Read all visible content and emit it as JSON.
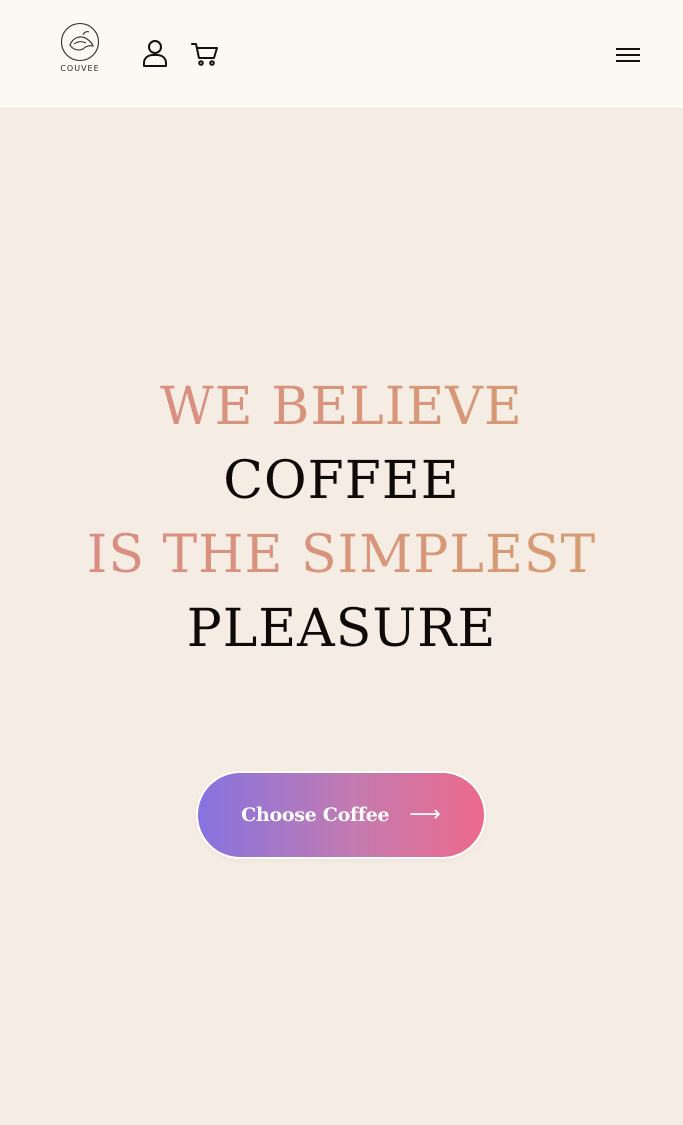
{
  "header": {
    "brand": "COUVEE",
    "icons": [
      "logo-icon",
      "user-icon",
      "cart-icon",
      "menu-icon"
    ]
  },
  "hero": {
    "line1": "WE BELIEVE",
    "line2": "COFFEE",
    "line3": "IS THE SIMPLEST",
    "line4": "PLEASURE"
  },
  "cta": {
    "label": "Choose Coffee",
    "arrow": "⟶"
  },
  "colors": {
    "background": "#f5ede3",
    "header_background": "#fcf8f2",
    "accent_start": "#dc8a86",
    "accent_end": "#d49f70",
    "dark_text": "#0d0a08",
    "button_start": "#8673e0",
    "button_end": "#ec6a8c"
  }
}
